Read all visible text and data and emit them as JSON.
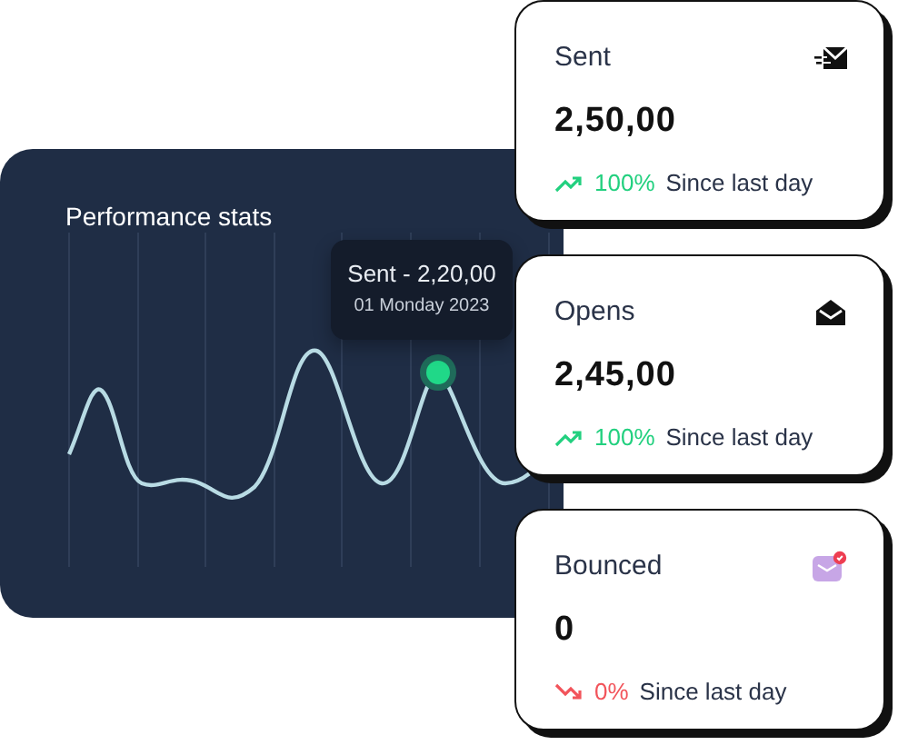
{
  "panel": {
    "title": "Performance stats",
    "tooltip": {
      "title": "Sent - 2,20,00",
      "subtitle": "01 Monday 2023"
    }
  },
  "cards": [
    {
      "kind": "sent",
      "title": "Sent",
      "value": "2,50,00",
      "rising": true,
      "change": "100%",
      "note": "Since last day"
    },
    {
      "kind": "opens",
      "title": "Opens",
      "value": "2,45,00",
      "rising": true,
      "change": "100%",
      "note": "Since last day"
    },
    {
      "kind": "bounced",
      "title": "Bounced",
      "value": "0",
      "rising": false,
      "change": "0%",
      "note": "Since last day"
    }
  ]
}
